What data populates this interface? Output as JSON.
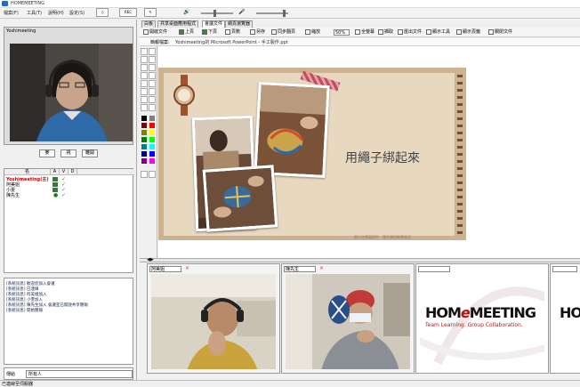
{
  "window": {
    "title": "HOMEMEETING"
  },
  "menu": [
    {
      "label": "檔案(F)"
    },
    {
      "label": "工具(T)"
    },
    {
      "label": "說明(H)"
    },
    {
      "label": "設定(S)"
    }
  ],
  "topbar": {
    "mic_label": "",
    "cam_label": "",
    "record_label": "REC"
  },
  "self_video": {
    "name": "Yoshimeeting"
  },
  "controls": [
    {
      "label": "麥"
    },
    {
      "label": "視"
    },
    {
      "label": "離開"
    }
  ],
  "user_list": {
    "headers": [
      "名",
      "A",
      "V",
      "D"
    ],
    "users": [
      {
        "name": "Yoshimeeting(主)",
        "color": "#c00000"
      },
      {
        "name": "阿美姐"
      },
      {
        "name": "小雯"
      },
      {
        "name": "陳先生"
      }
    ]
  },
  "chat": {
    "lines": [
      "[系統訊息] 歡迎您加入會議",
      "[系統訊息] 已連線",
      "[系統訊息] 阿美姐加入",
      "[系統訊息] 小雯加入",
      "[系統訊息] 陳先生加入 會議室已開啟共享簡報",
      "[系統訊息] 開始簡報"
    ],
    "to_label": "傳給",
    "to_value": "所有人"
  },
  "tabs": [
    {
      "label": "白板",
      "active": false
    },
    {
      "label": "共享桌面應用程式",
      "active": false
    },
    {
      "label": "會議文件",
      "active": true
    },
    {
      "label": "網頁瀏覽器",
      "active": false
    }
  ],
  "toolbar": {
    "items": [
      "開啟文件",
      "上頁",
      "下頁",
      "頁數",
      "另存",
      "同步翻頁",
      "縮放"
    ],
    "zoom": "50%",
    "right_items": [
      "全螢幕",
      "擷取",
      "匯出文件",
      "顯示工具",
      "顯示頁籤",
      "關閉文件"
    ]
  },
  "doc_path": {
    "label": "簡報檔案:",
    "value": "Yoshimeeting的 Microsoft PowerPoint - 手工製作.ppt"
  },
  "slide": {
    "text": "用繩子綁起來",
    "footer": "照片由學員提供 · 僅供課程教學使用"
  },
  "video_tiles": [
    {
      "name": "阿美姐"
    },
    {
      "name": "陳先生"
    },
    {
      "name": ""
    },
    {
      "name": ""
    }
  ],
  "brand": {
    "name_a": "HOM",
    "name_e": "e",
    "name_b": "MEETING",
    "tagline": "Team Learning. Group Collaboration."
  },
  "status": {
    "text": "已連線至伺服器"
  }
}
